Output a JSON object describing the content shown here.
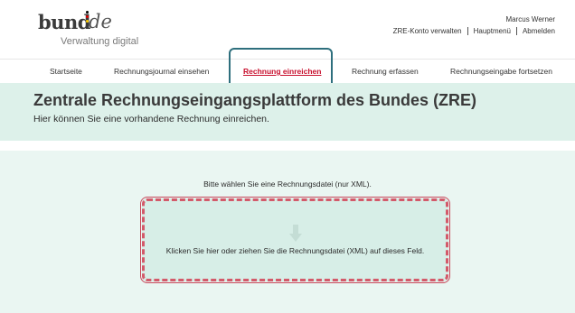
{
  "header": {
    "logo": {
      "brand": "bund",
      "tld": "de",
      "tagline": "Verwaltung digital",
      "flag_colors": [
        "#000000",
        "#dd0000",
        "#ffce00"
      ]
    },
    "user_name": "Marcus Werner",
    "meta_links": [
      "ZRE-Konto verwalten",
      "Hauptmenü",
      "Abmelden"
    ]
  },
  "nav": {
    "items": [
      {
        "label": "Startseite",
        "active": false
      },
      {
        "label": "Rechnungsjournal einsehen",
        "active": false
      },
      {
        "label": "Rechnung einreichen",
        "active": true
      },
      {
        "label": "Rechnung erfassen",
        "active": false
      },
      {
        "label": "Rechnungseingabe fortsetzen",
        "active": false
      }
    ]
  },
  "hero": {
    "title": "Zentrale Rechnungseingangsplattform des Bundes (ZRE)",
    "subtitle": "Hier können Sie eine vorhandene Rechnung einreichen."
  },
  "upload": {
    "prompt": "Bitte wählen Sie eine Rechnungsdatei (nur XML).",
    "dropzone_text": "Klicken Sie hier oder ziehen Sie die Rechnungsdatei (XML) auf dieses Feld.",
    "icon": "download-arrow-icon"
  },
  "colors": {
    "accent_red": "#c8102e",
    "hero_bg": "#ddf1ea",
    "section_bg": "#eaf6f2",
    "dropzone_bg": "#d7eee7",
    "dropzone_border": "#d35a6a",
    "nav_highlight": "#2e6f7d"
  }
}
